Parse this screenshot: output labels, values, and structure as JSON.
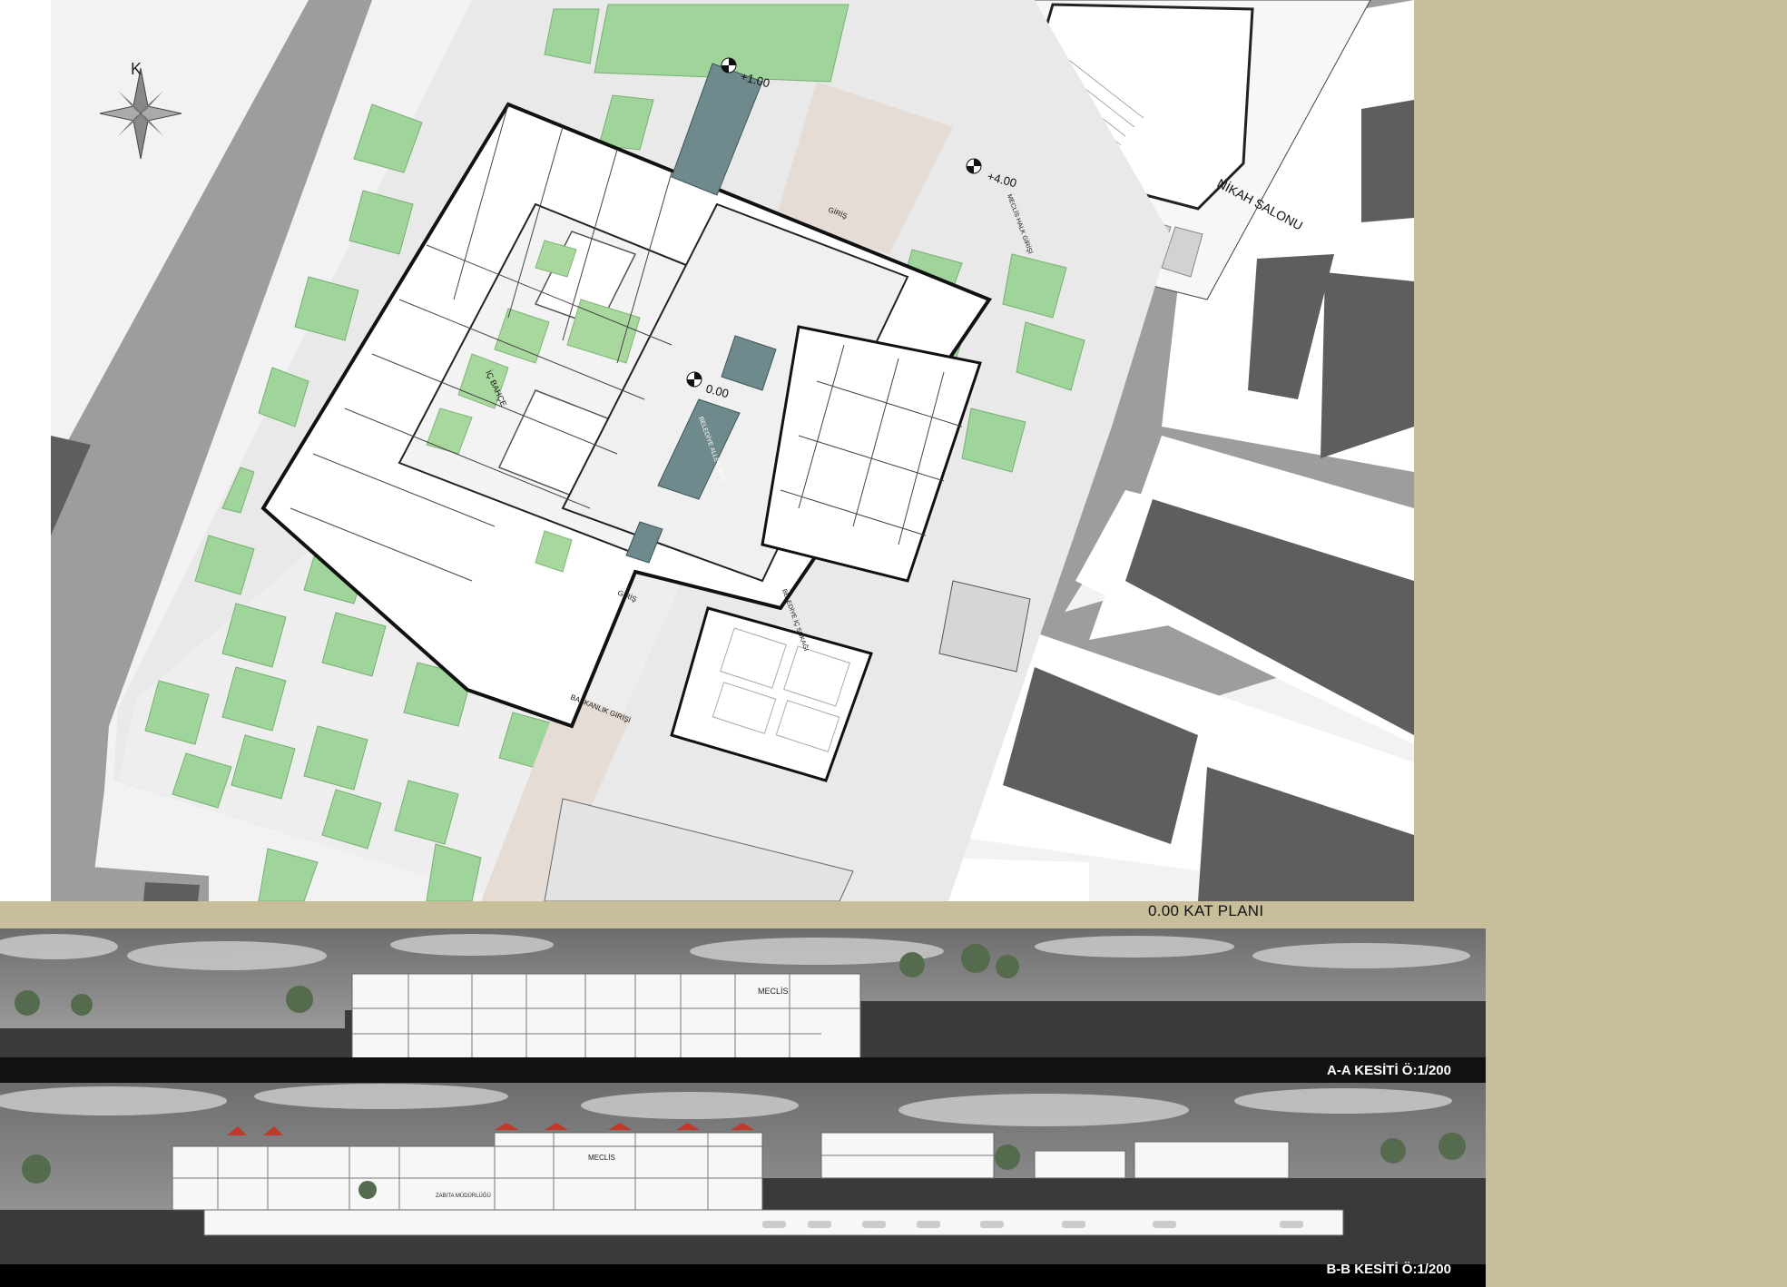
{
  "plan": {
    "north_label": "K",
    "levels": [
      "+1.00",
      "+4.00",
      "0.00"
    ],
    "labels": {
      "nikah": "NİKAH SALONU",
      "ic_bahce": "İÇ BAHÇE",
      "giris": "GİRİŞ",
      "giris2": "GİRİŞ",
      "baskanlik": "BAŞKANLIK GİRİŞİ",
      "belediye_aks": "BELEDİYE ALLEY AKSI",
      "belediye_ic": "BELEDİYE İÇ SOKAĞI",
      "meclis_giris": "MECLİS HALK GİRİŞİ"
    },
    "caption": "0.00 KAT PLANI"
  },
  "sections": {
    "a": {
      "caption": "A-A  KESİTİ Ö:1/200",
      "room_label": "MECLİS"
    },
    "b": {
      "caption": "B-B  KESİTİ Ö:1/200",
      "room_label": "MECLİS",
      "hall_label": "ZABITA MÜDÜRLÜĞÜ"
    }
  },
  "colors": {
    "green": "#9fd49a",
    "road": "#9d9d9d",
    "building": "#5e5e5e",
    "water": "#6e8a8c",
    "khaki": "#c8bf9a",
    "roof_red": "#c0392b"
  }
}
